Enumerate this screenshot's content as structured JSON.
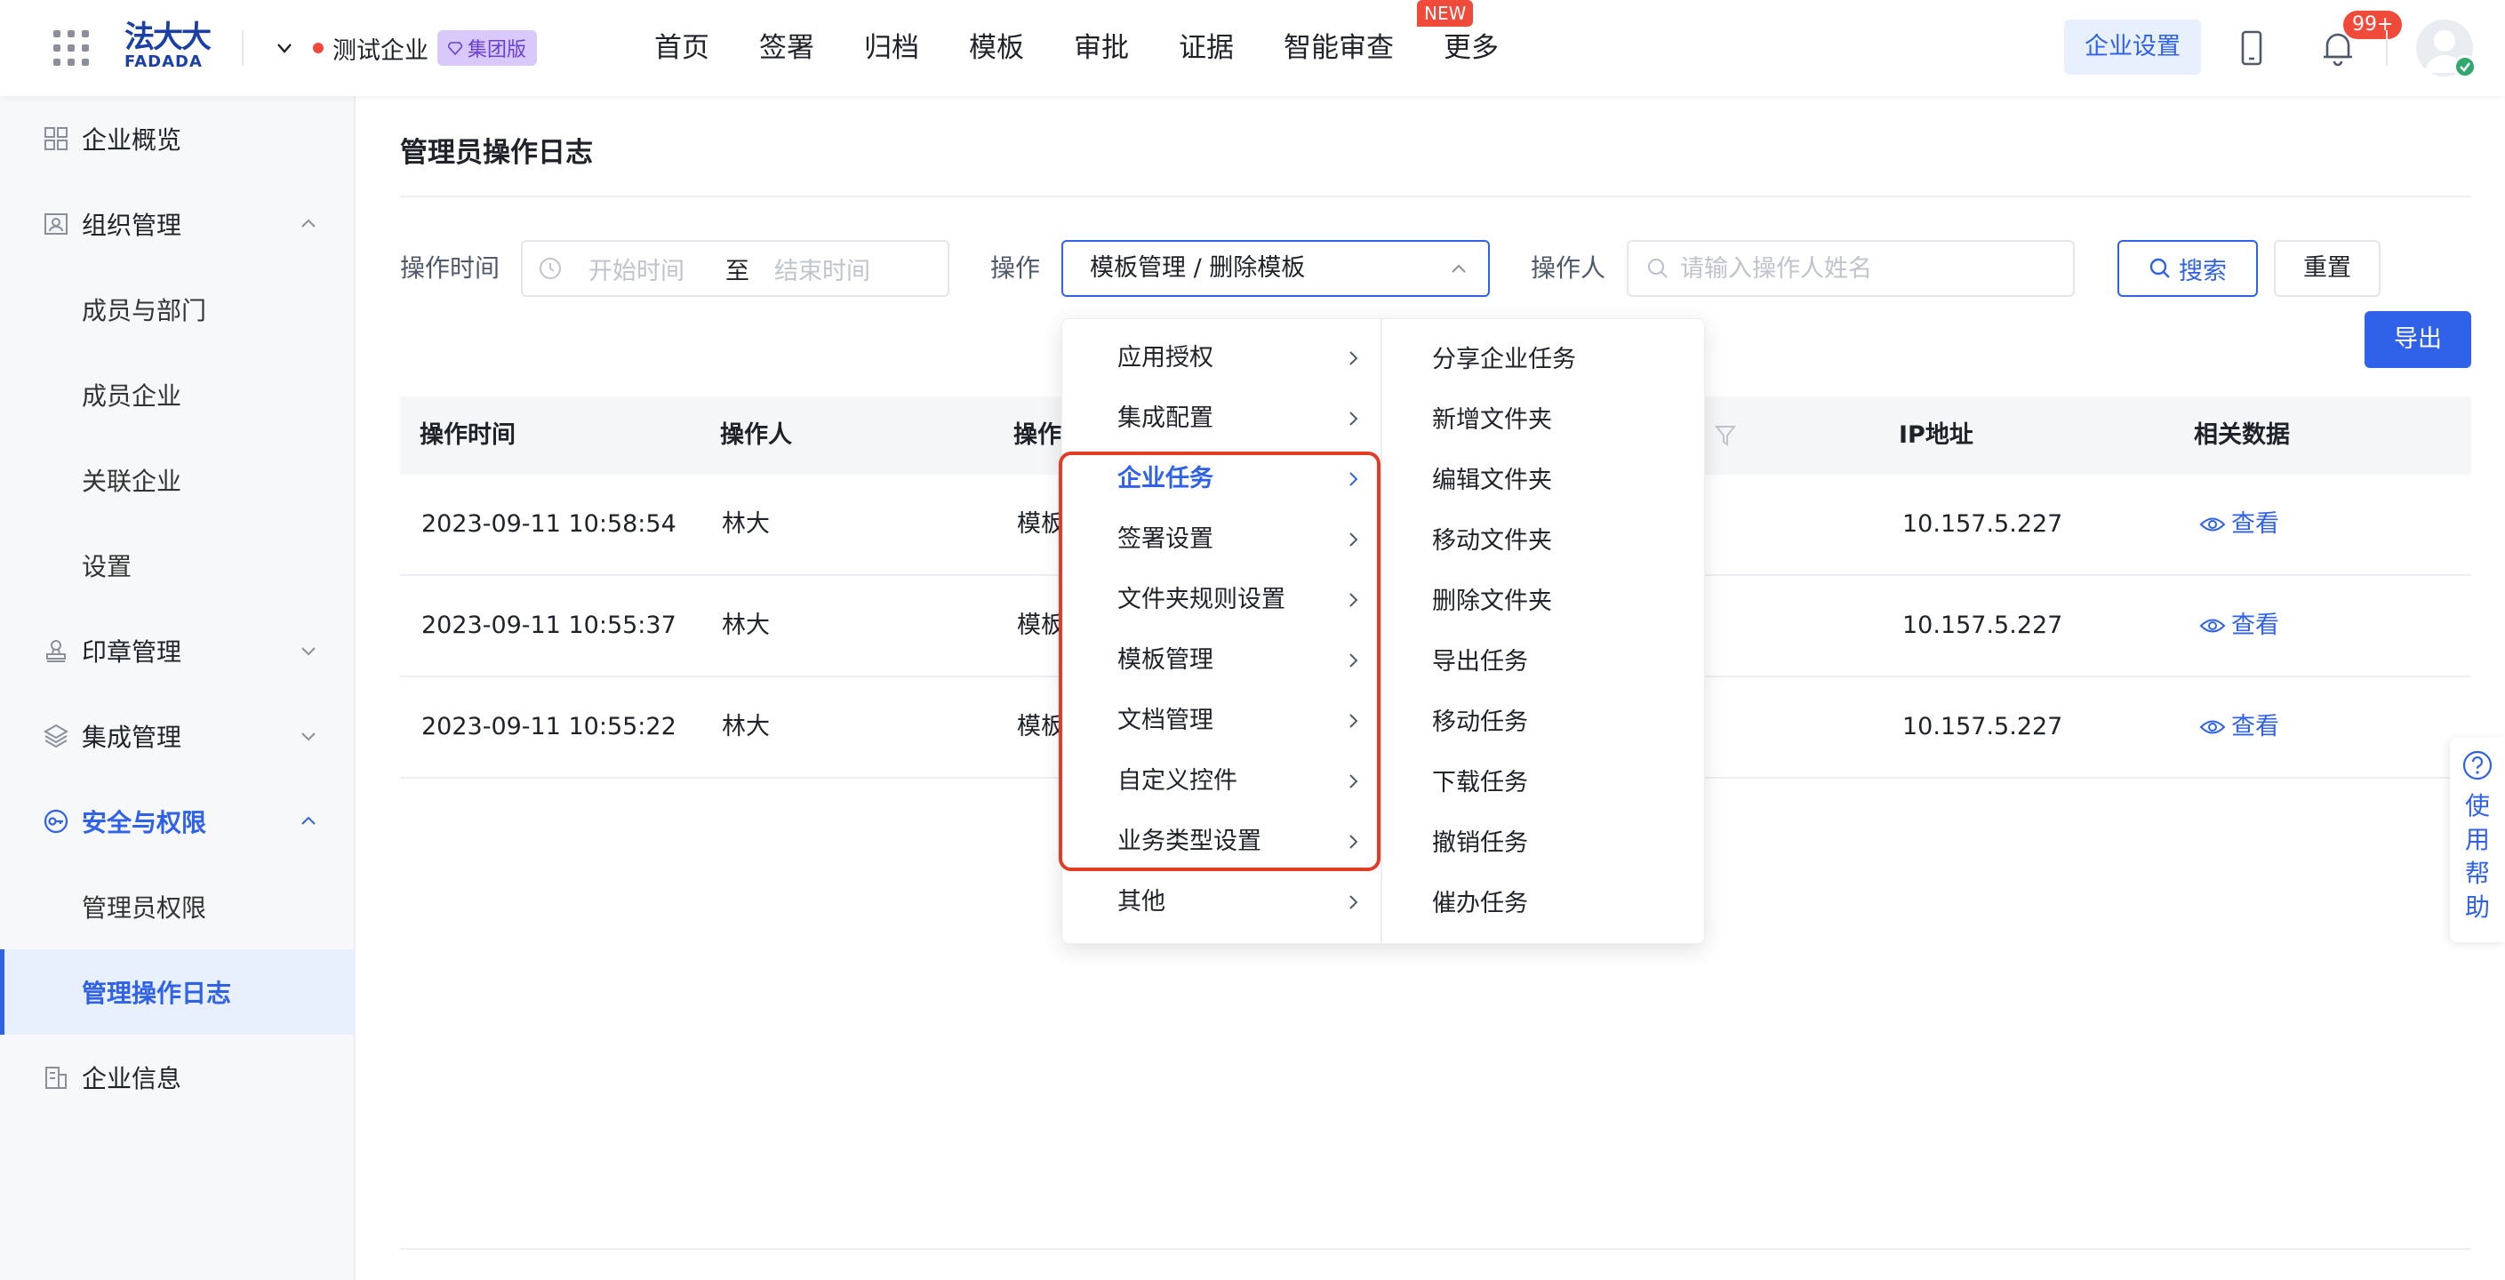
{
  "header": {
    "logo_cn": "法大大",
    "logo_en": "FADADA",
    "company_name": "测试企业",
    "edition_badge": "集团版",
    "nav": [
      "首页",
      "签署",
      "归档",
      "模板",
      "审批",
      "证据",
      "智能审查",
      "更多"
    ],
    "new_tag": "NEW",
    "corp_settings": "企业设置",
    "notification_count": "99+"
  },
  "sidebar": {
    "items": [
      {
        "label": "企业概览"
      },
      {
        "label": "组织管理"
      },
      {
        "label": "成员与部门"
      },
      {
        "label": "成员企业"
      },
      {
        "label": "关联企业"
      },
      {
        "label": "设置"
      },
      {
        "label": "印章管理"
      },
      {
        "label": "集成管理"
      },
      {
        "label": "安全与权限"
      },
      {
        "label": "管理员权限"
      },
      {
        "label": "管理操作日志"
      },
      {
        "label": "企业信息"
      }
    ]
  },
  "main": {
    "title": "管理员操作日志",
    "filters": {
      "time_label": "操作时间",
      "start_placeholder": "开始时间",
      "to": "至",
      "end_placeholder": "结束时间",
      "op_label": "操作",
      "op_value": "模板管理 / 删除模板",
      "operator_label": "操作人",
      "operator_placeholder": "请输入操作人姓名"
    },
    "buttons": {
      "search": "搜索",
      "reset": "重置",
      "export": "导出"
    },
    "table": {
      "headers": [
        "操作时间",
        "操作人",
        "操作",
        "IP地址",
        "相关数据"
      ],
      "rows": [
        {
          "time": "2023-09-11 10:58:54",
          "operator": "林大",
          "op": "模板",
          "ip": "10.157.5.227",
          "link": "查看"
        },
        {
          "time": "2023-09-11 10:55:37",
          "operator": "林大",
          "op": "模板",
          "ip": "10.157.5.227",
          "link": "查看"
        },
        {
          "time": "2023-09-11 10:55:22",
          "operator": "林大",
          "op": "模板",
          "ip": "10.157.5.227",
          "link": "查看"
        }
      ]
    }
  },
  "cascader": {
    "level1": [
      "应用授权",
      "集成配置",
      "企业任务",
      "签署设置",
      "文件夹规则设置",
      "模板管理",
      "文档管理",
      "自定义控件",
      "业务类型设置",
      "其他"
    ],
    "active_level1": "企业任务",
    "level2": [
      "分享企业任务",
      "新增文件夹",
      "编辑文件夹",
      "移动文件夹",
      "删除文件夹",
      "导出任务",
      "移动任务",
      "下载任务",
      "撤销任务",
      "催办任务"
    ]
  },
  "help": {
    "label": "使用帮助"
  },
  "colors": {
    "primary": "#2f62e8",
    "highlight": "#e23b26",
    "badge_red": "#f04a3a"
  }
}
